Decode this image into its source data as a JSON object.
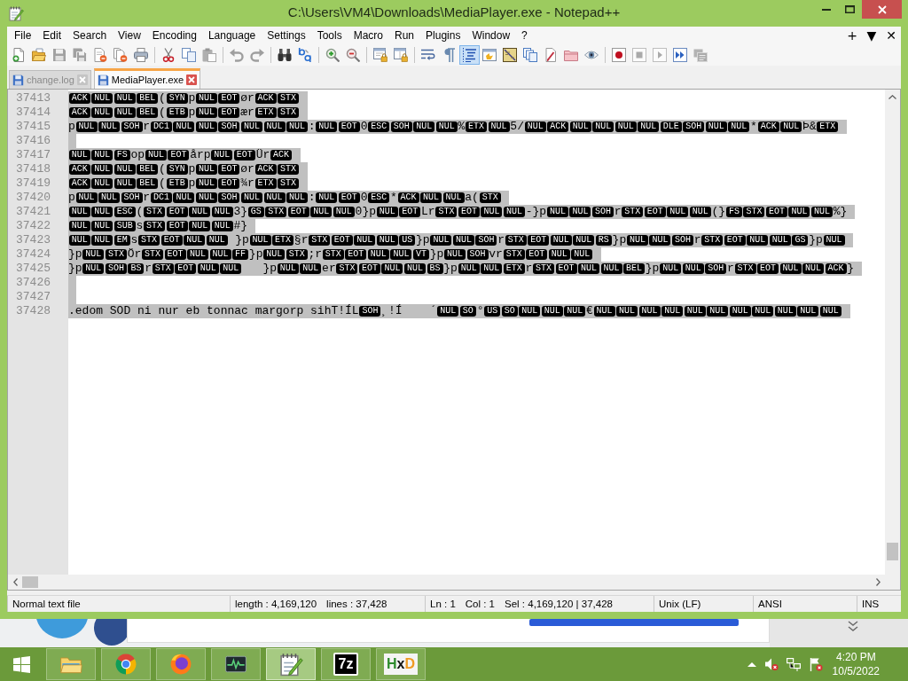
{
  "window": {
    "title": "C:\\Users\\VM4\\Downloads\\MediaPlayer.exe - Notepad++"
  },
  "menu": {
    "items": [
      "File",
      "Edit",
      "Search",
      "View",
      "Encoding",
      "Language",
      "Settings",
      "Tools",
      "Macro",
      "Run",
      "Plugins",
      "Window",
      "?"
    ],
    "right": [
      "+",
      "▼",
      "✕"
    ]
  },
  "toolbar": {
    "groups": [
      {
        "buttons": [
          {
            "kind": "new",
            "pressed": false,
            "disabled": false
          },
          {
            "kind": "open",
            "pressed": false,
            "disabled": false
          },
          {
            "kind": "save",
            "pressed": false,
            "disabled": true
          },
          {
            "kind": "save_all",
            "pressed": false,
            "disabled": true
          },
          {
            "kind": "close",
            "pressed": false,
            "disabled": false
          },
          {
            "kind": "close_all",
            "pressed": false,
            "disabled": false
          },
          {
            "kind": "print",
            "pressed": false,
            "disabled": false
          }
        ]
      },
      {
        "buttons": [
          {
            "kind": "cut",
            "pressed": false,
            "disabled": false
          },
          {
            "kind": "copy",
            "pressed": false,
            "disabled": false
          },
          {
            "kind": "paste",
            "pressed": false,
            "disabled": true
          }
        ]
      },
      {
        "buttons": [
          {
            "kind": "undo",
            "pressed": false,
            "disabled": true
          },
          {
            "kind": "redo",
            "pressed": false,
            "disabled": true
          }
        ]
      },
      {
        "buttons": [
          {
            "kind": "find",
            "pressed": false,
            "disabled": false
          },
          {
            "kind": "replace",
            "pressed": false,
            "disabled": false
          }
        ]
      },
      {
        "buttons": [
          {
            "kind": "zoom_in",
            "pressed": false,
            "disabled": false
          },
          {
            "kind": "zoom_out",
            "pressed": false,
            "disabled": false
          }
        ]
      },
      {
        "buttons": [
          {
            "kind": "sync_vertical",
            "pressed": false,
            "disabled": false
          },
          {
            "kind": "sync_horizontal",
            "pressed": false,
            "disabled": false
          }
        ]
      },
      {
        "buttons": [
          {
            "kind": "word_wrap",
            "pressed": false,
            "disabled": false
          },
          {
            "kind": "all_chars",
            "pressed": false,
            "disabled": false
          },
          {
            "kind": "indent_guide",
            "pressed": true,
            "disabled": false
          },
          {
            "kind": "user_language",
            "pressed": false,
            "disabled": false
          },
          {
            "kind": "document_map",
            "pressed": false,
            "disabled": false
          },
          {
            "kind": "function_list",
            "pressed": false,
            "disabled": false
          },
          {
            "kind": "folder_workspace",
            "pressed": false,
            "disabled": false
          },
          {
            "kind": "folder",
            "pressed": false,
            "disabled": false
          },
          {
            "kind": "monitoring",
            "pressed": false,
            "disabled": false
          }
        ]
      },
      {
        "buttons": [
          {
            "kind": "record",
            "pressed": false,
            "disabled": false
          },
          {
            "kind": "stop",
            "pressed": false,
            "disabled": true
          },
          {
            "kind": "play",
            "pressed": false,
            "disabled": true
          },
          {
            "kind": "play_multiple",
            "pressed": false,
            "disabled": false
          },
          {
            "kind": "save_macro",
            "pressed": false,
            "disabled": true
          }
        ]
      }
    ]
  },
  "tabs": [
    {
      "label": "change.log",
      "selected": false
    },
    {
      "label": "MediaPlayer.exe",
      "selected": true
    }
  ],
  "editor": {
    "lines": [
      {
        "number": "37413",
        "selected": true,
        "segments": [
          {
            "kind": "control",
            "text": "ACK"
          },
          {
            "kind": "control",
            "text": "NUL"
          },
          {
            "kind": "control",
            "text": "NUL"
          },
          {
            "kind": "control",
            "text": "BEL"
          },
          {
            "kind": "text",
            "text": "("
          },
          {
            "kind": "control",
            "text": "SYN"
          },
          {
            "kind": "text",
            "text": "p"
          },
          {
            "kind": "control",
            "text": "NUL"
          },
          {
            "kind": "control",
            "text": "EOT"
          },
          {
            "kind": "text",
            "text": "ør"
          },
          {
            "kind": "control",
            "text": "ACK"
          },
          {
            "kind": "control",
            "text": "STX"
          }
        ]
      },
      {
        "number": "37414",
        "selected": true,
        "segments": [
          {
            "kind": "control",
            "text": "ACK"
          },
          {
            "kind": "control",
            "text": "NUL"
          },
          {
            "kind": "control",
            "text": "NUL"
          },
          {
            "kind": "control",
            "text": "BEL"
          },
          {
            "kind": "text",
            "text": "("
          },
          {
            "kind": "control",
            "text": "ETB"
          },
          {
            "kind": "text",
            "text": "p"
          },
          {
            "kind": "control",
            "text": "NUL"
          },
          {
            "kind": "control",
            "text": "EOT"
          },
          {
            "kind": "text",
            "text": "ær"
          },
          {
            "kind": "control",
            "text": "ETX"
          },
          {
            "kind": "control",
            "text": "STX"
          }
        ]
      },
      {
        "number": "37415",
        "selected": true,
        "segments": [
          {
            "kind": "text",
            "text": "p"
          },
          {
            "kind": "control",
            "text": "NUL"
          },
          {
            "kind": "control",
            "text": "NUL"
          },
          {
            "kind": "control",
            "text": "SOH"
          },
          {
            "kind": "text",
            "text": "r"
          },
          {
            "kind": "control",
            "text": "DC1"
          },
          {
            "kind": "control",
            "text": "NUL"
          },
          {
            "kind": "control",
            "text": "NUL"
          },
          {
            "kind": "control",
            "text": "SOH"
          },
          {
            "kind": "control",
            "text": "NUL"
          },
          {
            "kind": "control",
            "text": "NUL"
          },
          {
            "kind": "control",
            "text": "NUL"
          },
          {
            "kind": "text",
            "text": ":"
          },
          {
            "kind": "control",
            "text": "NUL"
          },
          {
            "kind": "control",
            "text": "EOT"
          },
          {
            "kind": "text",
            "text": "0"
          },
          {
            "kind": "control",
            "text": "ESC"
          },
          {
            "kind": "control",
            "text": "SOH"
          },
          {
            "kind": "control",
            "text": "NUL"
          },
          {
            "kind": "control",
            "text": "NUL"
          },
          {
            "kind": "text",
            "text": "%"
          },
          {
            "kind": "control",
            "text": "ETX"
          },
          {
            "kind": "control",
            "text": "NUL"
          },
          {
            "kind": "text",
            "text": "5/"
          },
          {
            "kind": "control",
            "text": "NUL"
          },
          {
            "kind": "control",
            "text": "ACK"
          },
          {
            "kind": "control",
            "text": "NUL"
          },
          {
            "kind": "control",
            "text": "NUL"
          },
          {
            "kind": "control",
            "text": "NUL"
          },
          {
            "kind": "control",
            "text": "NUL"
          },
          {
            "kind": "control",
            "text": "DLE"
          },
          {
            "kind": "control",
            "text": "SOH"
          },
          {
            "kind": "control",
            "text": "NUL"
          },
          {
            "kind": "control",
            "text": "NUL"
          },
          {
            "kind": "text",
            "text": "*"
          },
          {
            "kind": "control",
            "text": "ACK"
          },
          {
            "kind": "control",
            "text": "NUL"
          },
          {
            "kind": "text",
            "text": "Þ&"
          },
          {
            "kind": "control",
            "text": "ETX"
          }
        ]
      },
      {
        "number": "37416",
        "selected": true
      },
      {
        "number": "37417",
        "selected": true,
        "segments": [
          {
            "kind": "control",
            "text": "NUL"
          },
          {
            "kind": "control",
            "text": "NUL"
          },
          {
            "kind": "control",
            "text": "FS"
          },
          {
            "kind": "text",
            "text": "op"
          },
          {
            "kind": "control",
            "text": "NUL"
          },
          {
            "kind": "control",
            "text": "EOT"
          },
          {
            "kind": "text",
            "text": "årp"
          },
          {
            "kind": "control",
            "text": "NUL"
          },
          {
            "kind": "control",
            "text": "EOT"
          },
          {
            "kind": "text",
            "text": "Ür"
          },
          {
            "kind": "control",
            "text": "ACK"
          }
        ]
      },
      {
        "number": "37418",
        "selected": true,
        "segments": [
          {
            "kind": "control",
            "text": "ACK"
          },
          {
            "kind": "control",
            "text": "NUL"
          },
          {
            "kind": "control",
            "text": "NUL"
          },
          {
            "kind": "control",
            "text": "BEL"
          },
          {
            "kind": "text",
            "text": "("
          },
          {
            "kind": "control",
            "text": "SYN"
          },
          {
            "kind": "text",
            "text": "p"
          },
          {
            "kind": "control",
            "text": "NUL"
          },
          {
            "kind": "control",
            "text": "EOT"
          },
          {
            "kind": "text",
            "text": "ør"
          },
          {
            "kind": "control",
            "text": "ACK"
          },
          {
            "kind": "control",
            "text": "STX"
          }
        ]
      },
      {
        "number": "37419",
        "selected": true,
        "segments": [
          {
            "kind": "control",
            "text": "ACK"
          },
          {
            "kind": "control",
            "text": "NUL"
          },
          {
            "kind": "control",
            "text": "NUL"
          },
          {
            "kind": "control",
            "text": "BEL"
          },
          {
            "kind": "text",
            "text": "("
          },
          {
            "kind": "control",
            "text": "ETB"
          },
          {
            "kind": "text",
            "text": "p"
          },
          {
            "kind": "control",
            "text": "NUL"
          },
          {
            "kind": "control",
            "text": "EOT"
          },
          {
            "kind": "text",
            "text": "¾r"
          },
          {
            "kind": "control",
            "text": "ETX"
          },
          {
            "kind": "control",
            "text": "STX"
          }
        ]
      },
      {
        "number": "37420",
        "selected": true,
        "segments": [
          {
            "kind": "text",
            "text": "p"
          },
          {
            "kind": "control",
            "text": "NUL"
          },
          {
            "kind": "control",
            "text": "NUL"
          },
          {
            "kind": "control",
            "text": "SOH"
          },
          {
            "kind": "text",
            "text": "r"
          },
          {
            "kind": "control",
            "text": "DC1"
          },
          {
            "kind": "control",
            "text": "NUL"
          },
          {
            "kind": "control",
            "text": "NUL"
          },
          {
            "kind": "control",
            "text": "SOH"
          },
          {
            "kind": "control",
            "text": "NUL"
          },
          {
            "kind": "control",
            "text": "NUL"
          },
          {
            "kind": "control",
            "text": "NUL"
          },
          {
            "kind": "text",
            "text": ":"
          },
          {
            "kind": "control",
            "text": "NUL"
          },
          {
            "kind": "control",
            "text": "EOT"
          },
          {
            "kind": "text",
            "text": "0"
          },
          {
            "kind": "control",
            "text": "ESC"
          },
          {
            "kind": "text",
            "text": "*"
          },
          {
            "kind": "control",
            "text": "ACK"
          },
          {
            "kind": "control",
            "text": "NUL"
          },
          {
            "kind": "control",
            "text": "NUL"
          },
          {
            "kind": "text",
            "text": "a("
          },
          {
            "kind": "control",
            "text": "STX"
          }
        ]
      },
      {
        "number": "37421",
        "selected": true,
        "segments": [
          {
            "kind": "control",
            "text": "NUL"
          },
          {
            "kind": "control",
            "text": "NUL"
          },
          {
            "kind": "control",
            "text": "ESC"
          },
          {
            "kind": "text",
            "text": "("
          },
          {
            "kind": "control",
            "text": "STX"
          },
          {
            "kind": "control",
            "text": "EOT"
          },
          {
            "kind": "control",
            "text": "NUL"
          },
          {
            "kind": "control",
            "text": "NUL"
          },
          {
            "kind": "text",
            "text": "3}"
          },
          {
            "kind": "control",
            "text": "GS"
          },
          {
            "kind": "control",
            "text": "STX"
          },
          {
            "kind": "control",
            "text": "EOT"
          },
          {
            "kind": "control",
            "text": "NUL"
          },
          {
            "kind": "control",
            "text": "NUL"
          },
          {
            "kind": "text",
            "text": "0}p"
          },
          {
            "kind": "control",
            "text": "NUL"
          },
          {
            "kind": "control",
            "text": "EOT"
          },
          {
            "kind": "text",
            "text": "Lr"
          },
          {
            "kind": "control",
            "text": "STX"
          },
          {
            "kind": "control",
            "text": "EOT"
          },
          {
            "kind": "control",
            "text": "NUL"
          },
          {
            "kind": "control",
            "text": "NUL"
          },
          {
            "kind": "text",
            "text": "-}p"
          },
          {
            "kind": "control",
            "text": "NUL"
          },
          {
            "kind": "control",
            "text": "NUL"
          },
          {
            "kind": "control",
            "text": "SOH"
          },
          {
            "kind": "text",
            "text": "r"
          },
          {
            "kind": "control",
            "text": "STX"
          },
          {
            "kind": "control",
            "text": "EOT"
          },
          {
            "kind": "control",
            "text": "NUL"
          },
          {
            "kind": "control",
            "text": "NUL"
          },
          {
            "kind": "text",
            "text": "(}"
          },
          {
            "kind": "control",
            "text": "FS"
          },
          {
            "kind": "control",
            "text": "STX"
          },
          {
            "kind": "control",
            "text": "EOT"
          },
          {
            "kind": "control",
            "text": "NUL"
          },
          {
            "kind": "control",
            "text": "NUL"
          },
          {
            "kind": "text",
            "text": "%}"
          }
        ]
      },
      {
        "number": "37422",
        "selected": true,
        "segments": [
          {
            "kind": "control",
            "text": "NUL"
          },
          {
            "kind": "control",
            "text": "NUL"
          },
          {
            "kind": "control",
            "text": "SUB"
          },
          {
            "kind": "text",
            "text": "s"
          },
          {
            "kind": "control",
            "text": "STX"
          },
          {
            "kind": "control",
            "text": "EOT"
          },
          {
            "kind": "control",
            "text": "NUL"
          },
          {
            "kind": "control",
            "text": "NUL"
          },
          {
            "kind": "text",
            "text": "#}"
          }
        ]
      },
      {
        "number": "37423",
        "selected": true,
        "segments": [
          {
            "kind": "control",
            "text": "NUL"
          },
          {
            "kind": "control",
            "text": "NUL"
          },
          {
            "kind": "control",
            "text": "EM"
          },
          {
            "kind": "text",
            "text": "s"
          },
          {
            "kind": "control",
            "text": "STX"
          },
          {
            "kind": "control",
            "text": "EOT"
          },
          {
            "kind": "control",
            "text": "NUL"
          },
          {
            "kind": "control",
            "text": "NUL"
          },
          {
            "kind": "text",
            "text": " }p"
          },
          {
            "kind": "control",
            "text": "NUL"
          },
          {
            "kind": "control",
            "text": "ETX"
          },
          {
            "kind": "text",
            "text": "§r"
          },
          {
            "kind": "control",
            "text": "STX"
          },
          {
            "kind": "control",
            "text": "EOT"
          },
          {
            "kind": "control",
            "text": "NUL"
          },
          {
            "kind": "control",
            "text": "NUL"
          },
          {
            "kind": "control",
            "text": "US"
          },
          {
            "kind": "text",
            "text": "}p"
          },
          {
            "kind": "control",
            "text": "NUL"
          },
          {
            "kind": "control",
            "text": "NUL"
          },
          {
            "kind": "control",
            "text": "SOH"
          },
          {
            "kind": "text",
            "text": "r"
          },
          {
            "kind": "control",
            "text": "STX"
          },
          {
            "kind": "control",
            "text": "EOT"
          },
          {
            "kind": "control",
            "text": "NUL"
          },
          {
            "kind": "control",
            "text": "NUL"
          },
          {
            "kind": "control",
            "text": "RS"
          },
          {
            "kind": "text",
            "text": "}p"
          },
          {
            "kind": "control",
            "text": "NUL"
          },
          {
            "kind": "control",
            "text": "NUL"
          },
          {
            "kind": "control",
            "text": "SOH"
          },
          {
            "kind": "text",
            "text": "r"
          },
          {
            "kind": "control",
            "text": "STX"
          },
          {
            "kind": "control",
            "text": "EOT"
          },
          {
            "kind": "control",
            "text": "NUL"
          },
          {
            "kind": "control",
            "text": "NUL"
          },
          {
            "kind": "control",
            "text": "GS"
          },
          {
            "kind": "text",
            "text": "}p"
          },
          {
            "kind": "control",
            "text": "NUL"
          }
        ]
      },
      {
        "number": "37424",
        "selected": true,
        "segments": [
          {
            "kind": "text",
            "text": "}p"
          },
          {
            "kind": "control",
            "text": "NUL"
          },
          {
            "kind": "control",
            "text": "STX"
          },
          {
            "kind": "text",
            "text": "Ör"
          },
          {
            "kind": "control",
            "text": "STX"
          },
          {
            "kind": "control",
            "text": "EOT"
          },
          {
            "kind": "control",
            "text": "NUL"
          },
          {
            "kind": "control",
            "text": "NUL"
          },
          {
            "kind": "control",
            "text": "FF"
          },
          {
            "kind": "text",
            "text": "}p"
          },
          {
            "kind": "control",
            "text": "NUL"
          },
          {
            "kind": "control",
            "text": "STX"
          },
          {
            "kind": "text",
            "text": ";r"
          },
          {
            "kind": "control",
            "text": "STX"
          },
          {
            "kind": "control",
            "text": "EOT"
          },
          {
            "kind": "control",
            "text": "NUL"
          },
          {
            "kind": "control",
            "text": "NUL"
          },
          {
            "kind": "control",
            "text": "VT"
          },
          {
            "kind": "text",
            "text": "}p"
          },
          {
            "kind": "control",
            "text": "NUL"
          },
          {
            "kind": "control",
            "text": "SOH"
          },
          {
            "kind": "text",
            "text": "vr"
          },
          {
            "kind": "control",
            "text": "STX"
          },
          {
            "kind": "control",
            "text": "EOT"
          },
          {
            "kind": "control",
            "text": "NUL"
          },
          {
            "kind": "control",
            "text": "NUL"
          }
        ]
      },
      {
        "number": "37425",
        "selected": true,
        "segments": [
          {
            "kind": "text",
            "text": "}p"
          },
          {
            "kind": "control",
            "text": "NUL"
          },
          {
            "kind": "control",
            "text": "SOH"
          },
          {
            "kind": "control",
            "text": "BS"
          },
          {
            "kind": "text",
            "text": "r"
          },
          {
            "kind": "control",
            "text": "STX"
          },
          {
            "kind": "control",
            "text": "EOT"
          },
          {
            "kind": "control",
            "text": "NUL"
          },
          {
            "kind": "control",
            "text": "NUL"
          },
          {
            "kind": "text",
            "text": "   }p"
          },
          {
            "kind": "control",
            "text": "NUL"
          },
          {
            "kind": "control",
            "text": "NUL"
          },
          {
            "kind": "text",
            "text": "er"
          },
          {
            "kind": "control",
            "text": "STX"
          },
          {
            "kind": "control",
            "text": "EOT"
          },
          {
            "kind": "control",
            "text": "NUL"
          },
          {
            "kind": "control",
            "text": "NUL"
          },
          {
            "kind": "control",
            "text": "BS"
          },
          {
            "kind": "text",
            "text": "}p"
          },
          {
            "kind": "control",
            "text": "NUL"
          },
          {
            "kind": "control",
            "text": "NUL"
          },
          {
            "kind": "control",
            "text": "ETX"
          },
          {
            "kind": "text",
            "text": "r"
          },
          {
            "kind": "control",
            "text": "STX"
          },
          {
            "kind": "control",
            "text": "EOT"
          },
          {
            "kind": "control",
            "text": "NUL"
          },
          {
            "kind": "control",
            "text": "NUL"
          },
          {
            "kind": "control",
            "text": "BEL"
          },
          {
            "kind": "text",
            "text": "}p"
          },
          {
            "kind": "control",
            "text": "NUL"
          },
          {
            "kind": "control",
            "text": "NUL"
          },
          {
            "kind": "control",
            "text": "SOH"
          },
          {
            "kind": "text",
            "text": "r"
          },
          {
            "kind": "control",
            "text": "STX"
          },
          {
            "kind": "control",
            "text": "EOT"
          },
          {
            "kind": "control",
            "text": "NUL"
          },
          {
            "kind": "control",
            "text": "NUL"
          },
          {
            "kind": "control",
            "text": "ACK"
          },
          {
            "kind": "text",
            "text": "}"
          }
        ]
      },
      {
        "number": "37426",
        "selected": true
      },
      {
        "number": "37427",
        "selected": true
      },
      {
        "number": "37428",
        "selected": true,
        "segments": [
          {
            "kind": "text",
            "text": ".edom SOD ni nur eb tonnac margorp sihT!ÍL"
          },
          {
            "kind": "control",
            "text": "SOH"
          },
          {
            "kind": "text",
            "text": "¸!Í    ´"
          },
          {
            "kind": "control",
            "text": "NUL"
          },
          {
            "kind": "control",
            "text": "SO"
          },
          {
            "kind": "text",
            "text": "°"
          },
          {
            "kind": "control",
            "text": "US"
          },
          {
            "kind": "control",
            "text": "SO"
          },
          {
            "kind": "control",
            "text": "NUL"
          },
          {
            "kind": "control",
            "text": "NUL"
          },
          {
            "kind": "control",
            "text": "NUL"
          },
          {
            "kind": "text",
            "text": "€"
          },
          {
            "kind": "control",
            "text": "NUL"
          },
          {
            "kind": "control",
            "text": "NUL"
          },
          {
            "kind": "control",
            "text": "NUL"
          },
          {
            "kind": "control",
            "text": "NUL"
          },
          {
            "kind": "control",
            "text": "NUL"
          },
          {
            "kind": "control",
            "text": "NUL"
          },
          {
            "kind": "control",
            "text": "NUL"
          },
          {
            "kind": "control",
            "text": "NUL"
          },
          {
            "kind": "control",
            "text": "NUL"
          },
          {
            "kind": "control",
            "text": "NUL"
          },
          {
            "kind": "control",
            "text": "NUL"
          }
        ]
      }
    ]
  },
  "status_bar": [
    {
      "items": [
        "Normal text file"
      ]
    },
    {
      "items": [
        "length : 4,169,120",
        "lines : 37,428"
      ]
    },
    {
      "items": [
        "Ln : 1",
        "Col : 1",
        "Sel : 4,169,120 | 37,428"
      ]
    },
    {
      "items": [
        "Unix (LF)"
      ]
    },
    {
      "items": [
        "ANSI"
      ]
    },
    {
      "items": [
        "INS"
      ]
    }
  ],
  "taskbar": {
    "apps": [
      {
        "kind": "explorer",
        "selected": false
      },
      {
        "kind": "chrome",
        "selected": false
      },
      {
        "kind": "firefox",
        "selected": false
      },
      {
        "kind": "monitor",
        "selected": false
      },
      {
        "kind": "notepad",
        "selected": true
      },
      {
        "kind": "archiver",
        "label": "7z",
        "selected": false
      },
      {
        "kind": "hex_editor",
        "label": "HxD",
        "selected": false
      }
    ],
    "clock": {
      "time": "4:20 PM",
      "date": "10/5/2022"
    }
  }
}
